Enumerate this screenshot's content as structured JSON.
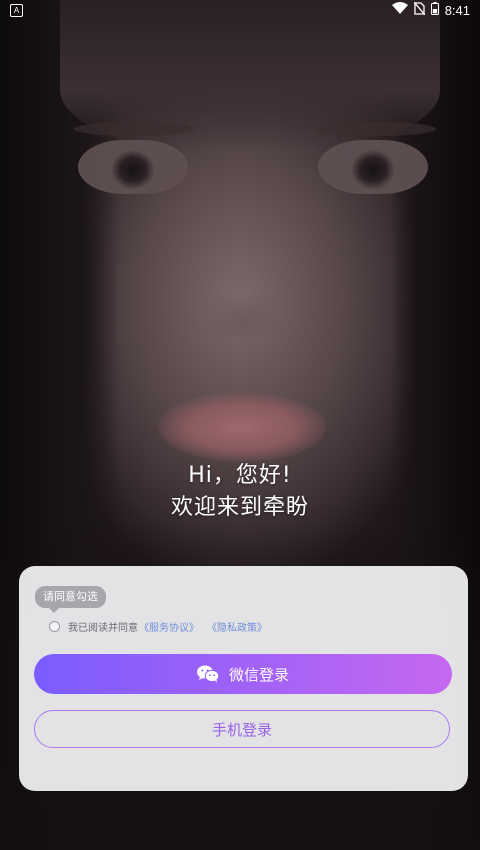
{
  "status_bar": {
    "app_icon_glyph": "A",
    "time": "8:41",
    "icons": [
      "wifi-icon",
      "no-sim-icon",
      "battery-icon"
    ]
  },
  "greeting": {
    "line1": "Hi，您好!",
    "line2": "欢迎来到牵盼"
  },
  "login": {
    "tooltip": "请同意勾选",
    "agree_text": "我已阅读并同意",
    "service_link": "《服务协议》",
    "privacy_link": "《隐私政策》",
    "wechat_label": "微信登录",
    "phone_label": "手机登录"
  },
  "colors": {
    "accent_start": "#7b5cff",
    "accent_end": "#c568f0",
    "link": "#6f8fd9"
  }
}
